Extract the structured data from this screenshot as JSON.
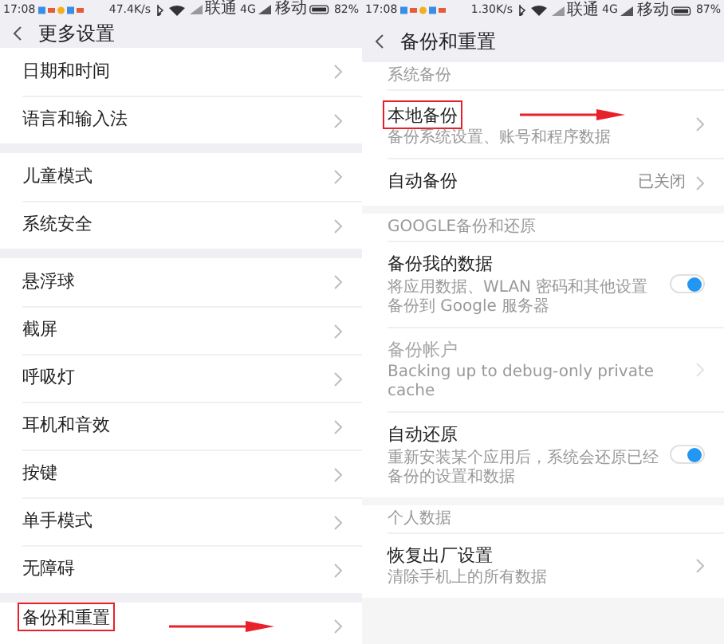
{
  "screens": [
    {
      "status_bar": {
        "time": "17:08",
        "speed": "47.4K/s",
        "carrier_1": "联通",
        "network": "4G",
        "carrier_2": "移动",
        "battery": "82%"
      },
      "title": "更多设置",
      "groups": [
        {
          "items": [
            {
              "label": "日期和时间",
              "highlighted": false
            },
            {
              "label": "语言和输入法",
              "highlighted": false
            }
          ]
        },
        {
          "items": [
            {
              "label": "儿童模式",
              "highlighted": false
            },
            {
              "label": "系统安全",
              "highlighted": false
            }
          ]
        },
        {
          "items": [
            {
              "label": "悬浮球",
              "highlighted": false
            },
            {
              "label": "截屏",
              "highlighted": false
            },
            {
              "label": "呼吸灯",
              "highlighted": false
            },
            {
              "label": "耳机和音效",
              "highlighted": false
            },
            {
              "label": "按键",
              "highlighted": false
            },
            {
              "label": "单手模式",
              "highlighted": false
            },
            {
              "label": "无障碍",
              "highlighted": false
            }
          ]
        },
        {
          "items": [
            {
              "label": "备份和重置",
              "highlighted": true
            }
          ]
        }
      ]
    },
    {
      "status_bar": {
        "time": "17:08",
        "speed": "1.30K/s",
        "carrier_1": "联通",
        "network": "4G",
        "carrier_2": "移动",
        "battery": "87%"
      },
      "title": "备份和重置",
      "groups": [
        {
          "header": "系统备份",
          "items": [
            {
              "kind": "link",
              "label": "本地备份",
              "subtitle": "备份系统设置、账号和程序数据",
              "highlighted": true,
              "disabled": false
            },
            {
              "kind": "link",
              "label": "自动备份",
              "value": "已关闭",
              "highlighted": false,
              "disabled": false
            }
          ]
        },
        {
          "header": "GOOGLE备份和还原",
          "items": [
            {
              "kind": "toggle",
              "label": "备份我的数据",
              "subtitle": "将应用数据、WLAN 密码和其他设置备份到 Google 服务器",
              "on": true,
              "highlighted": false,
              "disabled": false
            },
            {
              "kind": "link",
              "label": "备份帐户",
              "subtitle": "Backing up to debug-only private cache",
              "highlighted": false,
              "disabled": true
            },
            {
              "kind": "toggle",
              "label": "自动还原",
              "subtitle": "重新安装某个应用后，系统会还原已经备份的设置和数据",
              "on": true,
              "highlighted": false,
              "disabled": false
            }
          ]
        },
        {
          "header": "个人数据",
          "items": [
            {
              "kind": "link",
              "label": "恢复出厂设置",
              "subtitle": "清除手机上的所有数据",
              "highlighted": false,
              "disabled": false
            }
          ]
        }
      ]
    }
  ]
}
